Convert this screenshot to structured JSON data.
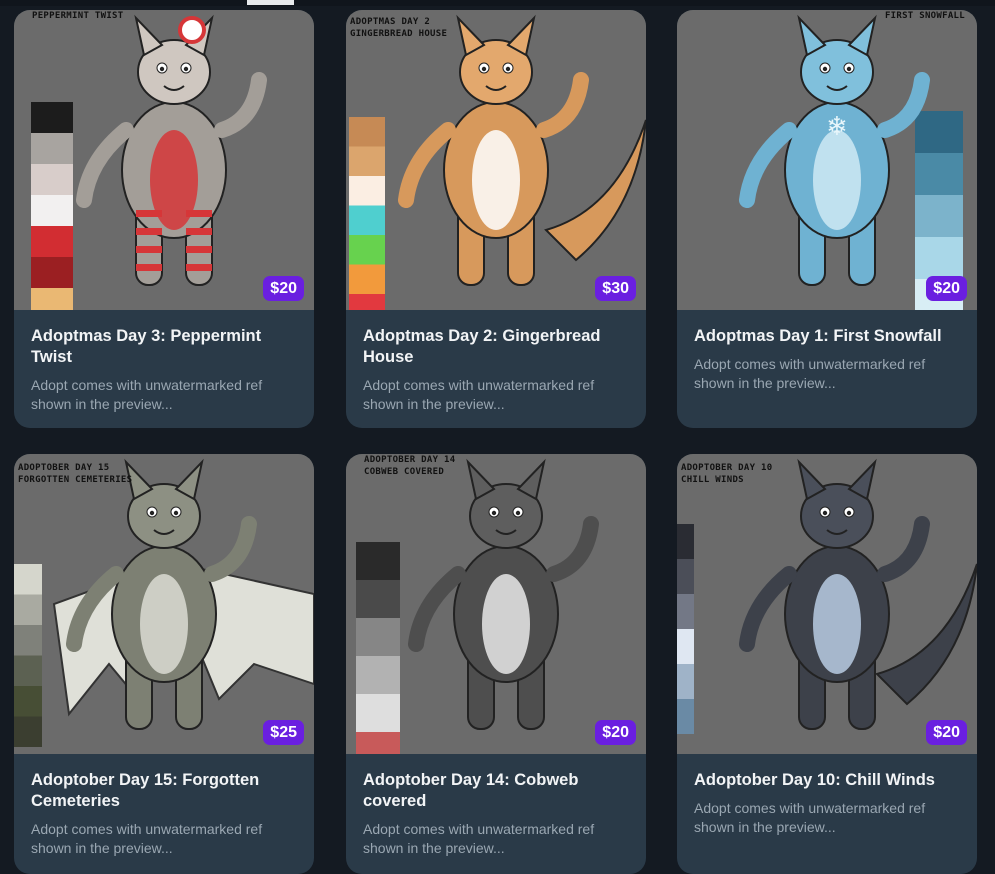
{
  "cards": [
    {
      "title": "Adoptmas Day 3: Peppermint Twist",
      "description": "Adopt comes with unwatermarked ref shown in the preview...",
      "price": "$20",
      "caption_lines": [
        "PEPPERMINT TWIST"
      ],
      "palette": [
        "#1c1c1c",
        "#a8a4a0",
        "#d8cdca",
        "#f2f0f0",
        "#d22d32",
        "#9b1f22",
        "#eab873"
      ],
      "character": {
        "body": "#a39e98",
        "accent": "#d63638",
        "head": "#cfc7c0",
        "icon": "sheep-character"
      }
    },
    {
      "title": "Adoptmas Day 2: Gingerbread House",
      "description": "Adopt comes with unwatermarked ref shown in the preview...",
      "price": "$30",
      "caption_lines": [
        "ADOPTMAS DAY 2",
        "GINGERBREAD HOUSE"
      ],
      "palette": [
        "#c68a55",
        "#dba56d",
        "#fbeee3",
        "#4fcfcf",
        "#67d24e",
        "#f29a3c",
        "#e2393f"
      ],
      "character": {
        "body": "#d7995c",
        "accent": "#ffffff",
        "head": "#e3a86d",
        "icon": "dragon-character"
      }
    },
    {
      "title": "Adoptmas Day 1: First Snowfall",
      "description": "Adopt comes with unwatermarked ref shown in the preview...",
      "price": "$20",
      "caption_lines": [
        "FIRST SNOWFALL"
      ],
      "palette": [
        "#2f6884",
        "#4a8aa6",
        "#7cb3cb",
        "#a9d7e8",
        "#d8eef5"
      ],
      "character": {
        "body": "#6fb2d2",
        "accent": "#cfe9f4",
        "head": "#80c0dc",
        "icon": "wolf-character"
      }
    },
    {
      "title": "Adoptober Day 15: Forgotten Cemeteries",
      "description": "Adopt comes with unwatermarked ref shown in the preview...",
      "price": "$25",
      "caption_lines": [
        "ADOPTOBER DAY 15",
        "FORGOTTEN CEMETERIES"
      ],
      "palette": [
        "#d5d6cc",
        "#a9aaa1",
        "#7f817a",
        "#5c6152",
        "#474e35",
        "#3b3e30"
      ],
      "character": {
        "body": "#7d8073",
        "accent": "#dadcd3",
        "head": "#8d9083",
        "icon": "bat-character"
      }
    },
    {
      "title": "Adoptober Day 14: Cobweb covered",
      "description": "Adopt comes with unwatermarked ref shown in the preview...",
      "price": "$20",
      "caption_lines": [
        "ADOPTOBER DAY 14",
        "COBWEB COVERED"
      ],
      "palette": [
        "#2a2a2a",
        "#4a4a4a",
        "#868686",
        "#b2b2b2",
        "#dedede",
        "#c85a5a"
      ],
      "character": {
        "body": "#4e4e4e",
        "accent": "#e9e9e9",
        "head": "#5e5e5e",
        "icon": "wolf-character"
      }
    },
    {
      "title": "Adoptober Day 10: Chill Winds",
      "description": "Adopt comes with unwatermarked ref shown in the preview...",
      "price": "$20",
      "caption_lines": [
        "ADOPTOBER DAY 10",
        "CHILL WINDS"
      ],
      "palette": [
        "#2a2c33",
        "#4b4e58",
        "#737886",
        "#dfe7f2",
        "#9fb3c8",
        "#6a8aa5"
      ],
      "character": {
        "body": "#3d414a",
        "accent": "#b8cde3",
        "head": "#4a4f5a",
        "icon": "crocodile-character"
      }
    }
  ]
}
